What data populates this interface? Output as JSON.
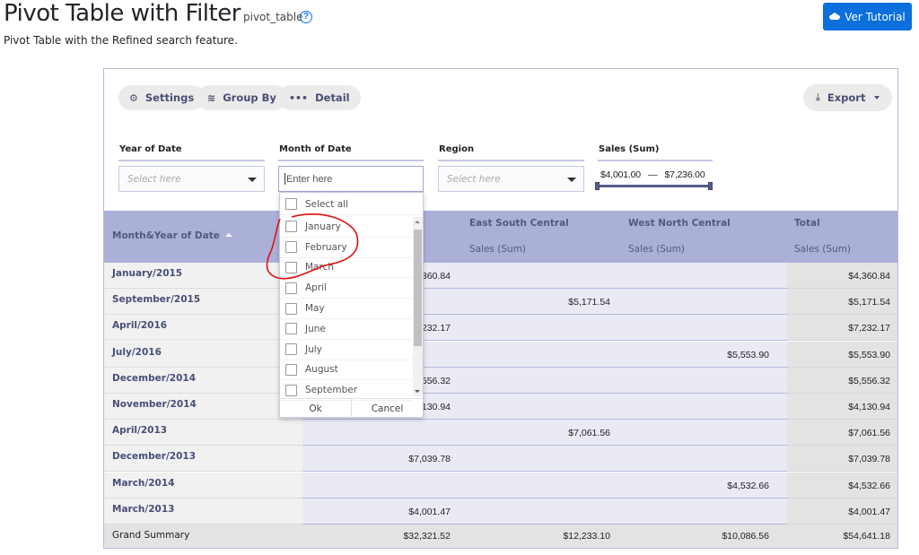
{
  "header": {
    "title": "Pivot Table with Filter",
    "subname": "pivot_table",
    "help_icon": "question-circle-icon",
    "description": "Pivot Table with the Refined search feature.",
    "tutorial_button": "Ver Tutorial",
    "tutorial_icon": "graduation-cap-icon"
  },
  "toolbar": {
    "settings": "Settings",
    "group_by": "Group By",
    "detail": "Detail",
    "export": "Export"
  },
  "filters": {
    "year": {
      "label": "Year of Date",
      "placeholder": "Select here"
    },
    "month": {
      "label": "Month of Date",
      "placeholder": "Enter here"
    },
    "region": {
      "label": "Region",
      "placeholder": "Select here"
    },
    "sales": {
      "label": "Sales (Sum)",
      "min": "$4,001.00",
      "separator": "—",
      "max": "$7,236.00",
      "range_fraction": [
        0.0,
        1.0
      ]
    }
  },
  "dropdown": {
    "select_all": "Select all",
    "options": [
      "January",
      "February",
      "March",
      "April",
      "May",
      "June",
      "July",
      "August",
      "September"
    ],
    "ok": "Ok",
    "cancel": "Cancel"
  },
  "table": {
    "row_header": "Month&Year of Date",
    "columns": [
      {
        "name": "",
        "measure": ""
      },
      {
        "name": "East South Central",
        "measure": "Sales (Sum)"
      },
      {
        "name": "West North Central",
        "measure": "Sales (Sum)"
      },
      {
        "name": "Total",
        "measure": "Sales (Sum)"
      }
    ],
    "rows": [
      {
        "label": "January/2015",
        "c1": "$4,360.84",
        "c2": "",
        "c3": "",
        "total": "$4,360.84"
      },
      {
        "label": "September/2015",
        "c1": "",
        "c2": "$5,171.54",
        "c3": "",
        "total": "$5,171.54"
      },
      {
        "label": "April/2016",
        "c1": "$7,232.17",
        "c2": "",
        "c3": "",
        "total": "$7,232.17"
      },
      {
        "label": "July/2016",
        "c1": "",
        "c2": "",
        "c3": "$5,553.90",
        "total": "$5,553.90"
      },
      {
        "label": "December/2014",
        "c1": "$5,556.32",
        "c2": "",
        "c3": "",
        "total": "$5,556.32"
      },
      {
        "label": "November/2014",
        "c1": "$4,130.94",
        "c2": "",
        "c3": "",
        "total": "$4,130.94"
      },
      {
        "label": "April/2013",
        "c1": "",
        "c2": "$7,061.56",
        "c3": "",
        "total": "$7,061.56"
      },
      {
        "label": "December/2013",
        "c1": "$7,039.78",
        "c2": "",
        "c3": "",
        "total": "$7,039.78"
      },
      {
        "label": "March/2014",
        "c1": "",
        "c2": "",
        "c3": "$4,532.66",
        "total": "$4,532.66"
      },
      {
        "label": "March/2013",
        "c1": "$4,001.47",
        "c2": "",
        "c3": "",
        "total": "$4,001.47"
      }
    ],
    "grand": {
      "label": "Grand Summary",
      "c1": "$32,321.52",
      "c2": "$12,233.10",
      "c3": "$10,086.56",
      "total": "$54,641.18"
    }
  },
  "colors": {
    "accent": "#0b6fdc",
    "header_bg": "#abb0d9",
    "cell_bg": "#eaeaf4",
    "total_bg": "#e3e3e3",
    "annotation": "#e01010"
  }
}
